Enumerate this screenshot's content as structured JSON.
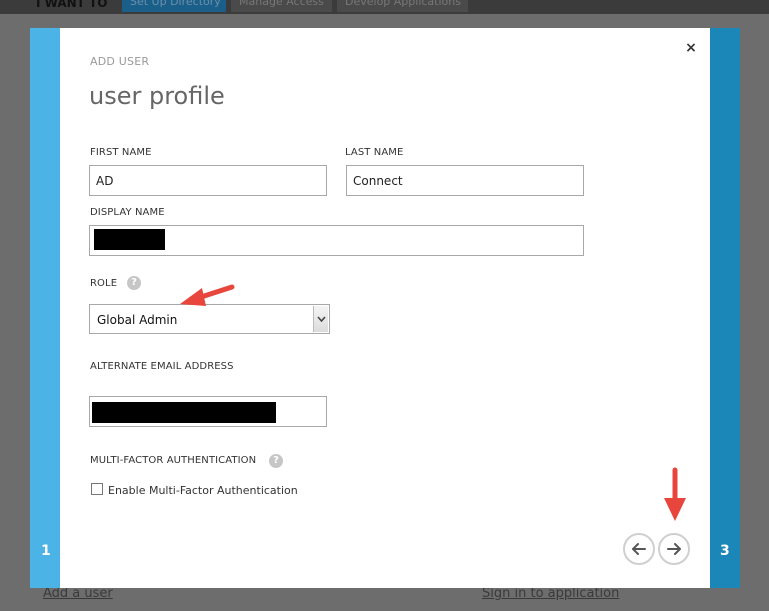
{
  "background": {
    "title": "I WANT TO",
    "tabs": [
      {
        "label": "Set Up Directory",
        "active": true
      },
      {
        "label": "Manage Access",
        "active": false
      },
      {
        "label": "Develop Applications",
        "active": false
      }
    ],
    "links": [
      "Add a user",
      "Sign in to application"
    ]
  },
  "wizard": {
    "step_left": "1",
    "step_right": "3",
    "overline": "ADD USER",
    "heading": "user profile",
    "close_glyph": "×",
    "first_name": {
      "label": "FIRST NAME",
      "value": "AD"
    },
    "last_name": {
      "label": "LAST NAME",
      "value": "Connect"
    },
    "display_name": {
      "label": "DISPLAY NAME"
    },
    "role": {
      "label": "ROLE",
      "value": "Global Admin"
    },
    "alt_email": {
      "label": "ALTERNATE EMAIL ADDRESS"
    },
    "mfa": {
      "label": "MULTI-FACTOR AUTHENTICATION",
      "checkbox_label": "Enable Multi-Factor Authentication",
      "checked": false
    },
    "help_glyph": "?"
  },
  "colors": {
    "accent_left": "#4cb3e6",
    "accent_right": "#1b87b8",
    "annotation_red": "#e8453c"
  },
  "icons": {
    "close": "close-icon",
    "help": "help-icon",
    "dropdown": "chevron-down-icon",
    "back": "arrow-left-icon",
    "next": "arrow-right-icon"
  }
}
